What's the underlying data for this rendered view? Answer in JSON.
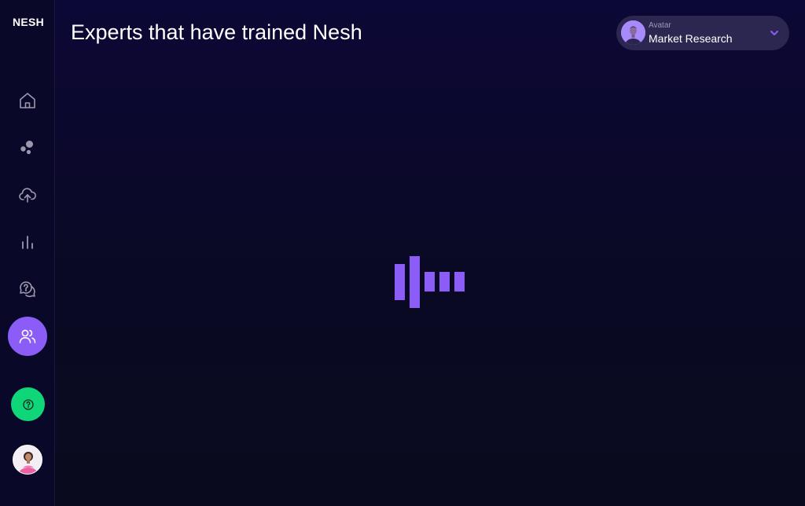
{
  "app": {
    "logo": "NESH",
    "page_title": "Experts that have trained Nesh"
  },
  "sidebar": {
    "items": [
      {
        "name": "home",
        "icon": "home-icon",
        "active": false
      },
      {
        "name": "bubbles",
        "icon": "bubbles-icon",
        "active": false
      },
      {
        "name": "upload",
        "icon": "cloud-upload-icon",
        "active": false
      },
      {
        "name": "analytics",
        "icon": "bar-chart-icon",
        "active": false
      },
      {
        "name": "faq",
        "icon": "question-chat-icon",
        "active": false
      },
      {
        "name": "experts",
        "icon": "users-icon",
        "active": true
      }
    ],
    "help_icon": "help-circle-icon",
    "profile_icon": "user-avatar"
  },
  "avatar_selector": {
    "label": "Avatar",
    "value": "Market Research",
    "icon": "chevron-down-icon"
  },
  "loader": {
    "icon": "loading-bars-icon"
  },
  "colors": {
    "background": "#0c0836",
    "sidebar": "#0a0828",
    "accent": "#8b5cf6",
    "help": "#10d67a",
    "icon": "#9b98ad",
    "selector_bg": "#2b2750"
  }
}
